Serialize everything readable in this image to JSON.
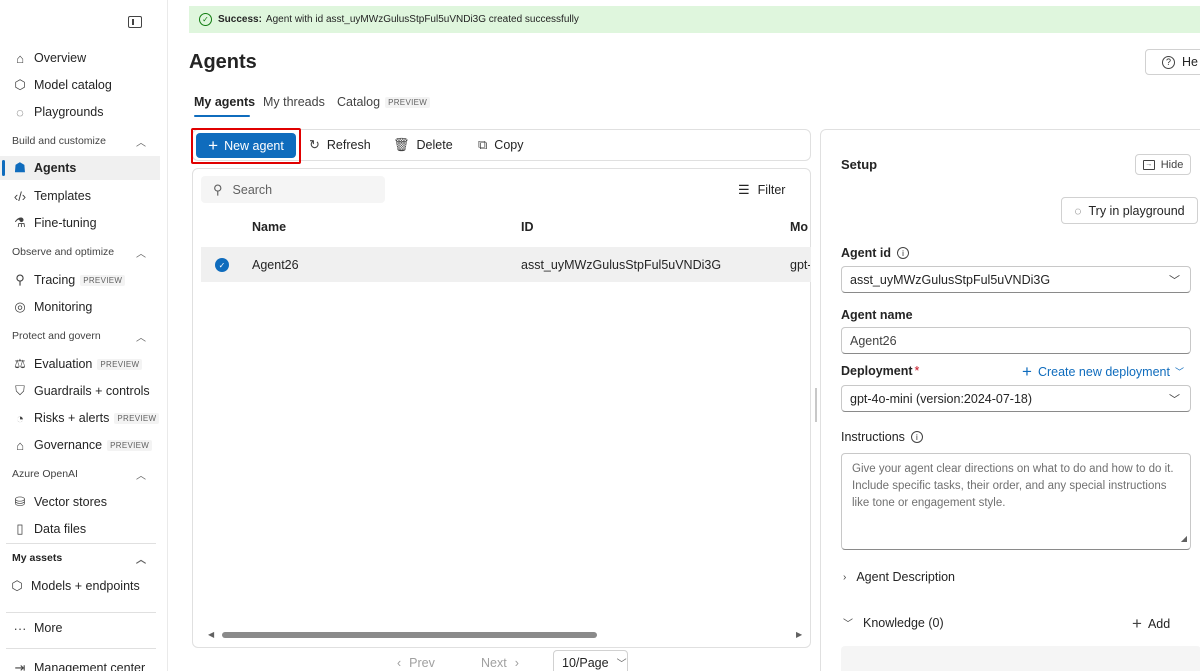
{
  "sidebar": {
    "items": {
      "overview": "Overview",
      "model_catalog": "Model catalog",
      "playgrounds": "Playgrounds",
      "agents": "Agents",
      "templates": "Templates",
      "fine_tuning": "Fine-tuning",
      "tracing": "Tracing",
      "monitoring": "Monitoring",
      "evaluation": "Evaluation",
      "guardrails": "Guardrails + controls",
      "risks": "Risks + alerts",
      "governance": "Governance",
      "vector_stores": "Vector stores",
      "data_files": "Data files",
      "models_endpoints": "Models + endpoints",
      "more": "More",
      "management_center": "Management center"
    },
    "sections": {
      "build": "Build and customize",
      "observe": "Observe and optimize",
      "protect": "Protect and govern",
      "azure_openai": "Azure OpenAI",
      "my_assets": "My assets"
    },
    "preview_badge": "PREVIEW"
  },
  "banner": {
    "strong": "Success:",
    "message": "Agent with id asst_uyMWzGulusStpFul5uVNDi3G created successfully"
  },
  "header": {
    "title": "Agents",
    "help_label": "He"
  },
  "tabs": {
    "my_agents": "My agents",
    "my_threads": "My threads",
    "catalog": "Catalog",
    "catalog_badge": "PREVIEW"
  },
  "toolbar": {
    "new_agent": "New agent",
    "refresh": "Refresh",
    "delete": "Delete",
    "copy": "Copy"
  },
  "table": {
    "search_placeholder": "Search",
    "filter_label": "Filter",
    "columns": {
      "name": "Name",
      "id": "ID",
      "model": "Mo"
    },
    "rows": [
      {
        "name": "Agent26",
        "id": "asst_uyMWzGulusStpFul5uVNDi3G",
        "model": "gpt-"
      }
    ],
    "pager": {
      "prev": "Prev",
      "next": "Next",
      "page_size": "10/Page"
    }
  },
  "setup": {
    "title": "Setup",
    "hide_label": "Hide",
    "try_label": "Try in playground",
    "agent_id_label": "Agent id",
    "agent_id_value": "asst_uyMWzGulusStpFul5uVNDi3G",
    "agent_name_label": "Agent name",
    "agent_name_value": "Agent26",
    "deployment_label": "Deployment",
    "create_deployment": "Create new deployment",
    "deployment_value": "gpt-4o-mini (version:2024-07-18)",
    "instructions_label": "Instructions",
    "instructions_placeholder": "Give your agent clear directions on what to do and how to do it. Include specific tasks, their order, and any special instructions like tone or engagement style.",
    "agent_description": "Agent Description",
    "knowledge": "Knowledge (0)",
    "add_label": "Add"
  }
}
